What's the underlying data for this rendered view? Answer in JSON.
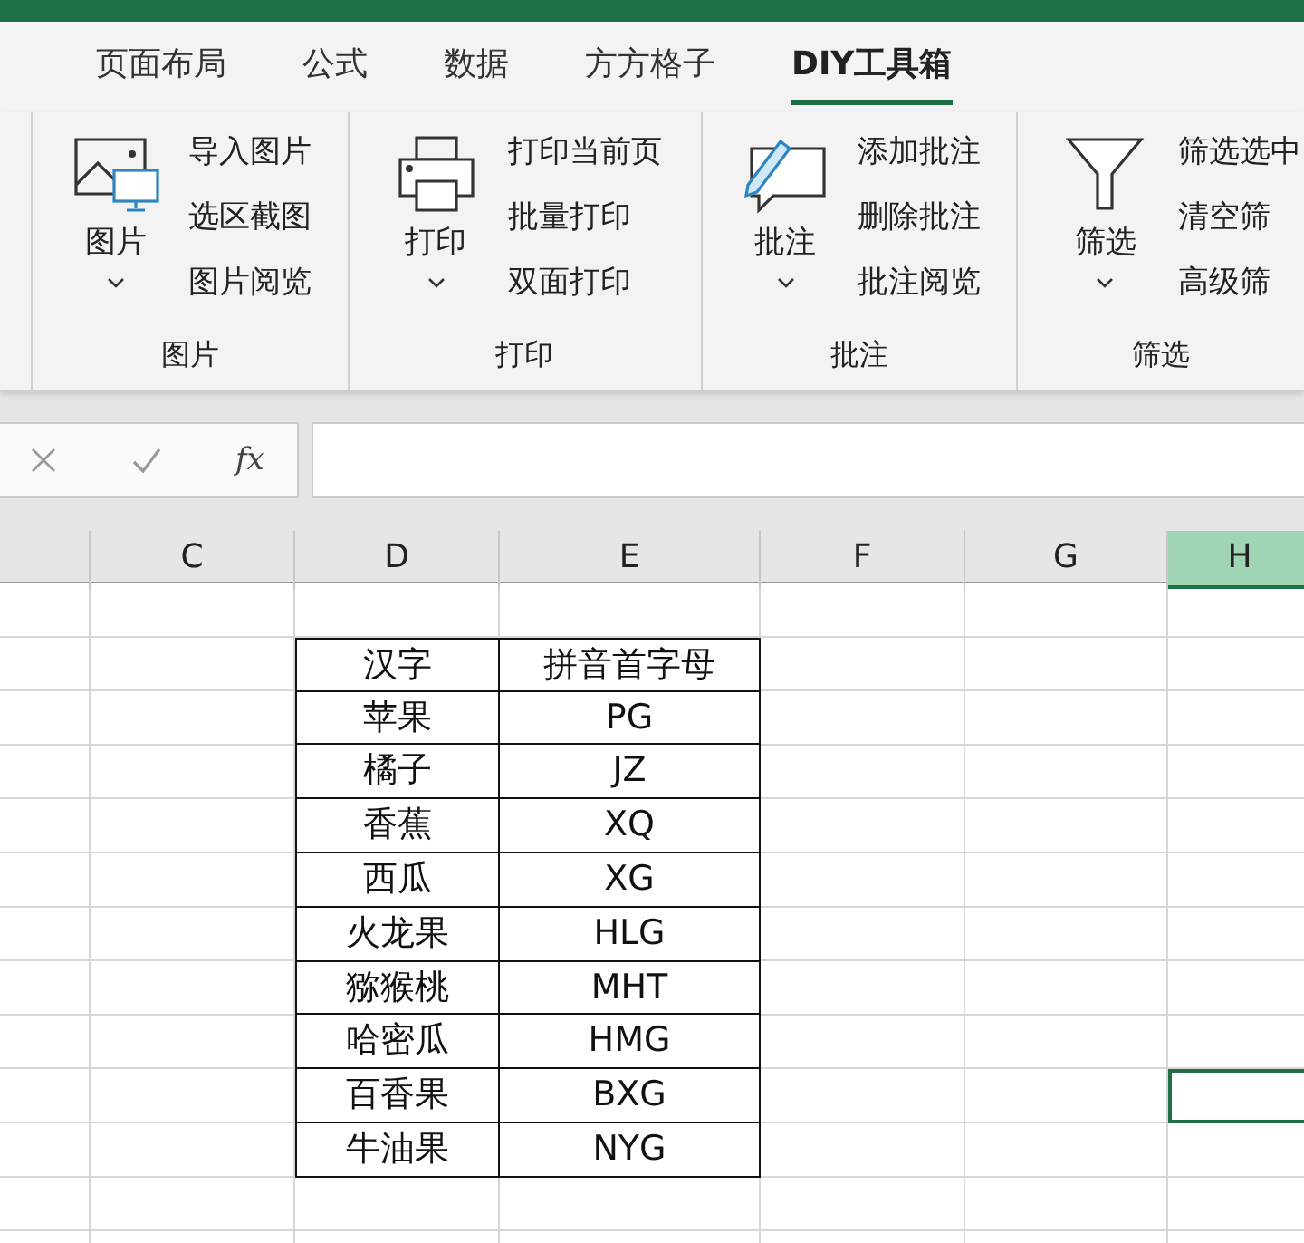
{
  "tabs": [
    {
      "label": "页面布局",
      "selected": false
    },
    {
      "label": "公式",
      "selected": false
    },
    {
      "label": "数据",
      "selected": false
    },
    {
      "label": "方方格子",
      "selected": false
    },
    {
      "label": "DIY工具箱",
      "selected": true
    }
  ],
  "ribbon_groups": [
    {
      "kind": "picture",
      "button": "图片",
      "items": [
        "导入图片",
        "选区截图",
        "图片阅览"
      ],
      "label": "图片"
    },
    {
      "kind": "print",
      "button": "打印",
      "items": [
        "打印当前页",
        "批量打印",
        "双面打印"
      ],
      "label": "打印"
    },
    {
      "kind": "comment",
      "button": "批注",
      "items": [
        "添加批注",
        "删除批注",
        "批注阅览"
      ],
      "label": "批注"
    },
    {
      "kind": "filter",
      "button": "筛选",
      "items": [
        "筛选选中",
        "清空筛",
        "高级筛"
      ],
      "label": "筛选"
    }
  ],
  "formula_bar": {
    "fx": "fx"
  },
  "columns": [
    {
      "label": "C",
      "selected": false
    },
    {
      "label": "D",
      "selected": false
    },
    {
      "label": "E",
      "selected": false
    },
    {
      "label": "F",
      "selected": false
    },
    {
      "label": "G",
      "selected": false
    },
    {
      "label": "H",
      "selected": true
    }
  ],
  "table": {
    "rows": [
      {
        "cells": [
          "汉字",
          "拼音首字母"
        ],
        "h_selected": false
      },
      {
        "cells": [
          "苹果",
          "PG"
        ],
        "h_selected": false
      },
      {
        "cells": [
          "橘子",
          "JZ"
        ],
        "h_selected": false
      },
      {
        "cells": [
          "香蕉",
          "XQ"
        ],
        "h_selected": false
      },
      {
        "cells": [
          "西瓜",
          "XG"
        ],
        "h_selected": false
      },
      {
        "cells": [
          "火龙果",
          "HLG"
        ],
        "h_selected": false
      },
      {
        "cells": [
          "猕猴桃",
          "MHT"
        ],
        "h_selected": false
      },
      {
        "cells": [
          "哈密瓜",
          "HMG"
        ],
        "h_selected": false
      },
      {
        "cells": [
          "百香果",
          "BXG"
        ],
        "h_selected": true
      },
      {
        "cells": [
          "牛油果",
          "NYG"
        ],
        "h_selected": false
      }
    ]
  }
}
